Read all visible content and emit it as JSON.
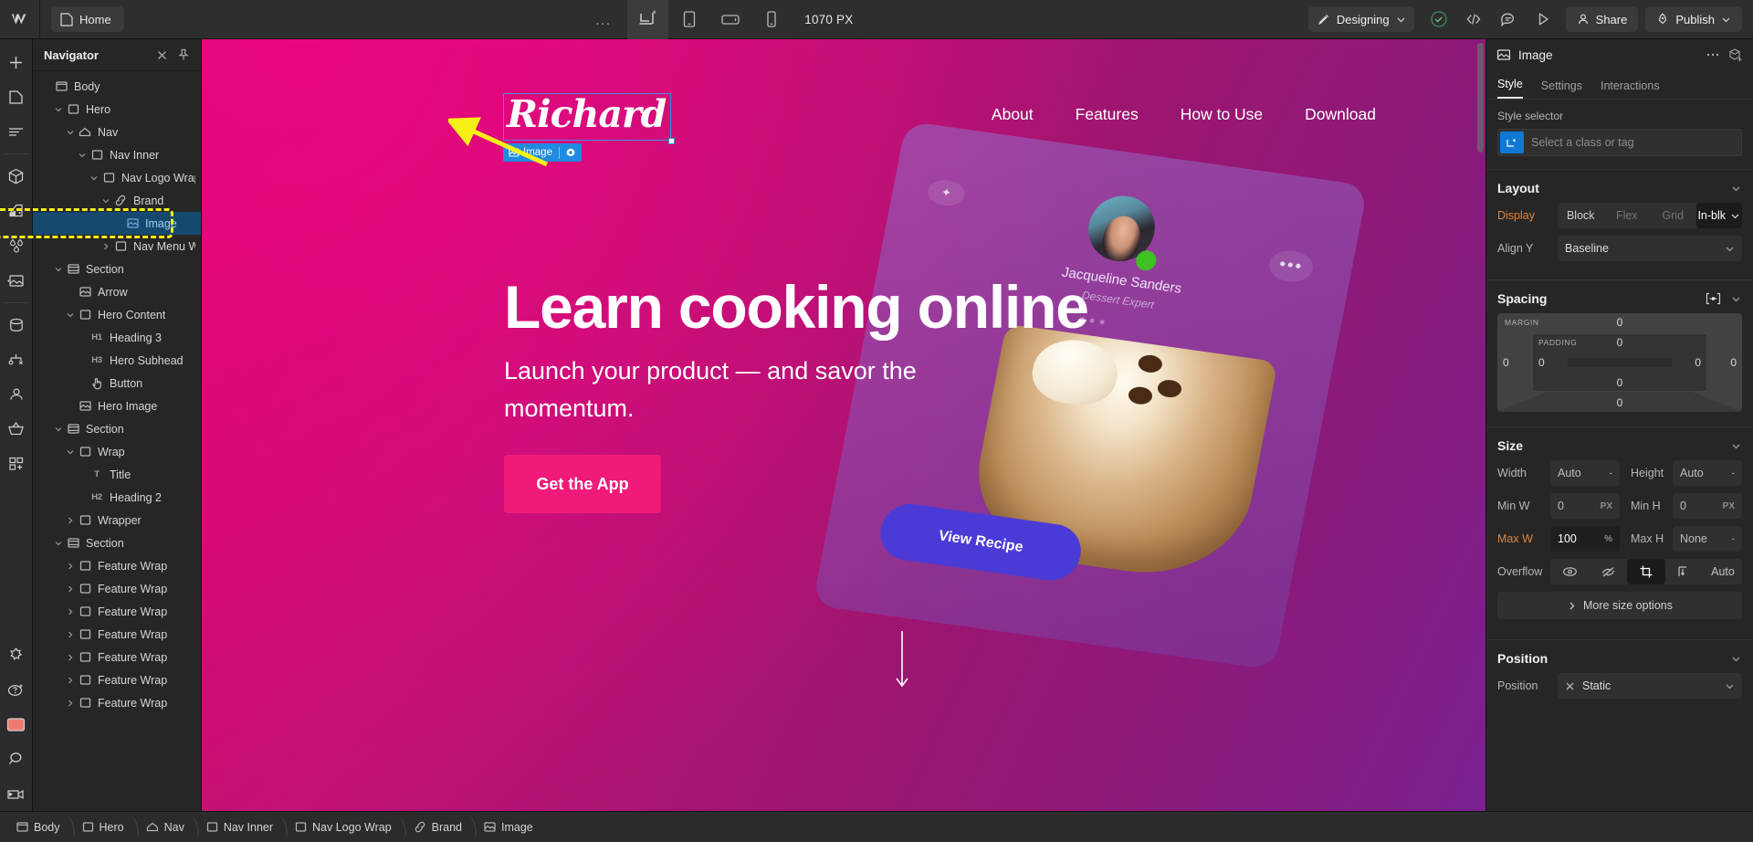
{
  "topbar": {
    "logo_icon": "webflow-logo-icon",
    "page_chip": {
      "label": "Home",
      "icon": "page-icon"
    },
    "more_dots": "...",
    "breakpoints": [
      {
        "name": "desktop",
        "icon": "desktop-breakpoint-icon",
        "active": true
      },
      {
        "name": "tablet",
        "icon": "tablet-breakpoint-icon",
        "active": false
      },
      {
        "name": "mobile-landscape",
        "icon": "mobile-landscape-breakpoint-icon",
        "active": false
      },
      {
        "name": "mobile-portrait",
        "icon": "mobile-portrait-breakpoint-icon",
        "active": false
      }
    ],
    "viewport_width": "1070 PX",
    "mode": {
      "label": "Designing",
      "icon": "paintbrush-icon",
      "chevron": "chevron-down-icon"
    },
    "status_icon": "check-circle-icon",
    "code_icon": "code-brackets-icon",
    "comments_icon": "comment-icon",
    "preview_icon": "play-icon",
    "share": {
      "label": "Share",
      "icon": "person-icon"
    },
    "publish": {
      "label": "Publish",
      "icon": "rocket-icon",
      "chevron": "chevron-down-icon"
    }
  },
  "rail": {
    "items": [
      {
        "name": "add-elements",
        "icon": "plus-icon"
      },
      {
        "name": "pages",
        "icon": "page-icon"
      },
      {
        "name": "navigator",
        "icon": "navigator-lines-icon"
      },
      {
        "name": "components",
        "icon": "cube-icon"
      },
      {
        "name": "variables",
        "icon": "paint-swatch-icon"
      },
      {
        "name": "style-manager",
        "icon": "drops-icon"
      },
      {
        "name": "assets",
        "icon": "image-icon"
      },
      {
        "name": "cms",
        "icon": "database-icon"
      },
      {
        "name": "logic",
        "icon": "logic-node-icon"
      },
      {
        "name": "users",
        "icon": "user-icon"
      },
      {
        "name": "ecommerce",
        "icon": "basket-icon"
      },
      {
        "name": "apps",
        "icon": "apps-grid-icon"
      },
      {
        "name": "ai-assist",
        "icon": "sparkle-icon"
      },
      {
        "name": "help",
        "icon": "question-badge-icon"
      },
      {
        "name": "selected-tool",
        "icon": "red-rect-icon"
      },
      {
        "name": "search",
        "icon": "search-icon"
      },
      {
        "name": "video",
        "icon": "video-camera-icon"
      }
    ]
  },
  "navigator": {
    "title": "Navigator",
    "close_icon": "close-icon",
    "pin_icon": "pin-icon",
    "tree": [
      {
        "label": "Body",
        "depth": 0,
        "icon": "body-box-icon",
        "caret": "",
        "selected": false
      },
      {
        "label": "Hero",
        "depth": 1,
        "icon": "div-box-icon",
        "caret": "down",
        "selected": false
      },
      {
        "label": "Nav",
        "depth": 2,
        "icon": "nav-home-icon",
        "caret": "down",
        "selected": false
      },
      {
        "label": "Nav Inner",
        "depth": 3,
        "icon": "div-box-icon",
        "caret": "down",
        "selected": false
      },
      {
        "label": "Nav Logo Wrap",
        "depth": 4,
        "icon": "div-box-icon",
        "caret": "down",
        "selected": false
      },
      {
        "label": "Brand",
        "depth": 5,
        "icon": "link-icon",
        "caret": "down",
        "selected": false
      },
      {
        "label": "Image",
        "depth": 6,
        "icon": "image-icon",
        "caret": "",
        "selected": true
      },
      {
        "label": "Nav Menu Wrap",
        "depth": 5,
        "icon": "div-box-icon",
        "caret": "right",
        "selected": false
      },
      {
        "label": "Section",
        "depth": 1,
        "icon": "section-icon",
        "caret": "down",
        "selected": false
      },
      {
        "label": "Arrow",
        "depth": 2,
        "icon": "image-icon",
        "caret": "",
        "selected": false
      },
      {
        "label": "Hero Content",
        "depth": 2,
        "icon": "div-box-icon",
        "caret": "down",
        "selected": false
      },
      {
        "label": "Heading 3",
        "depth": 3,
        "icon": "H1",
        "caret": "",
        "selected": false
      },
      {
        "label": "Hero Subhead",
        "depth": 3,
        "icon": "H3",
        "caret": "",
        "selected": false
      },
      {
        "label": "Button",
        "depth": 3,
        "icon": "pointer-hand-icon",
        "caret": "",
        "selected": false
      },
      {
        "label": "Hero Image",
        "depth": 2,
        "icon": "image-icon",
        "caret": "",
        "selected": false
      },
      {
        "label": "Section",
        "depth": 1,
        "icon": "section-icon",
        "caret": "down",
        "selected": false
      },
      {
        "label": "Wrap",
        "depth": 2,
        "icon": "div-box-icon",
        "caret": "down",
        "selected": false
      },
      {
        "label": "Title",
        "depth": 3,
        "icon": "T",
        "caret": "",
        "selected": false
      },
      {
        "label": "Heading 2",
        "depth": 3,
        "icon": "H2",
        "caret": "",
        "selected": false
      },
      {
        "label": "Wrapper",
        "depth": 2,
        "icon": "div-box-icon",
        "caret": "right",
        "selected": false
      },
      {
        "label": "Section",
        "depth": 1,
        "icon": "section-icon",
        "caret": "down",
        "selected": false
      },
      {
        "label": "Feature Wrap",
        "depth": 2,
        "icon": "div-box-icon",
        "caret": "right",
        "selected": false
      },
      {
        "label": "Feature Wrap",
        "depth": 2,
        "icon": "div-box-icon",
        "caret": "right",
        "selected": false
      },
      {
        "label": "Feature Wrap",
        "depth": 2,
        "icon": "div-box-icon",
        "caret": "right",
        "selected": false
      },
      {
        "label": "Feature Wrap",
        "depth": 2,
        "icon": "div-box-icon",
        "caret": "right",
        "selected": false
      },
      {
        "label": "Feature Wrap",
        "depth": 2,
        "icon": "div-box-icon",
        "caret": "right",
        "selected": false
      },
      {
        "label": "Feature Wrap",
        "depth": 2,
        "icon": "div-box-icon",
        "caret": "right",
        "selected": false
      },
      {
        "label": "Feature Wrap",
        "depth": 2,
        "icon": "div-box-icon",
        "caret": "right",
        "selected": false
      }
    ]
  },
  "canvas": {
    "site": {
      "logo_text": "Richard",
      "nav_links": [
        "About",
        "Features",
        "How to Use",
        "Download"
      ],
      "heading": "Learn cooking online",
      "subhead": "Launch your product — and savor the momentum.",
      "cta_label": "Get the App",
      "phone": {
        "person_name": "Jacqueline Sanders",
        "person_role": "Dessert Expert",
        "recipe_label": "View Recipe",
        "star_glyph": "✦",
        "dots_glyph": "•••"
      }
    },
    "selection_badge": {
      "label": "Image",
      "icon": "image-icon",
      "settings_icon": "gear-icon"
    }
  },
  "breadcrumbs": [
    {
      "label": "Body",
      "icon": "body-box-icon"
    },
    {
      "label": "Hero",
      "icon": "div-box-icon"
    },
    {
      "label": "Nav",
      "icon": "nav-home-icon"
    },
    {
      "label": "Nav Inner",
      "icon": "div-box-icon"
    },
    {
      "label": "Nav Logo Wrap",
      "icon": "div-box-icon"
    },
    {
      "label": "Brand",
      "icon": "link-icon"
    },
    {
      "label": "Image",
      "icon": "image-icon"
    }
  ],
  "style_panel": {
    "element_name": "Image",
    "element_icon": "image-icon",
    "more_icon": "ellipsis-icon",
    "component_icon": "create-component-icon",
    "tabs": [
      {
        "label": "Style",
        "active": true
      },
      {
        "label": "Settings",
        "active": false
      },
      {
        "label": "Interactions",
        "active": false
      }
    ],
    "style_selector": {
      "label": "Style selector",
      "placeholder": "Select a class or tag",
      "swatch_icon": "element-tag-icon",
      "swatch_color": "#1078d4"
    },
    "layout": {
      "title": "Layout",
      "display_label": "Display",
      "display_options": [
        "Block",
        "Flex",
        "Grid",
        "In-blk"
      ],
      "display_value": "In-blk",
      "align_y_label": "Align Y",
      "align_y_value": "Baseline"
    },
    "spacing": {
      "title": "Spacing",
      "margin_label": "MARGIN",
      "padding_label": "PADDING",
      "margin_top": "0",
      "margin_right": "0",
      "margin_bottom": "0",
      "margin_left": "0",
      "padding_top": "0",
      "padding_right": "0",
      "padding_bottom": "0",
      "padding_left": "0",
      "link_icon": "spacing-link-icon"
    },
    "size": {
      "title": "Size",
      "width_label": "Width",
      "width_value": "Auto",
      "width_unit": "-",
      "height_label": "Height",
      "height_value": "Auto",
      "height_unit": "-",
      "minw_label": "Min W",
      "minw_value": "0",
      "minw_unit": "PX",
      "minh_label": "Min H",
      "minh_value": "0",
      "minh_unit": "PX",
      "maxw_label": "Max W",
      "maxw_value": "100",
      "maxw_unit": "%",
      "maxh_label": "Max H",
      "maxh_value": "None",
      "maxh_unit": "-",
      "overflow_label": "Overflow",
      "overflow_options": [
        "visible-eye-icon",
        "hidden-eye-slash-icon",
        "scroll-crop-icon",
        "auto-bars-icon"
      ],
      "overflow_auto_label": "Auto",
      "more_size_label": "More size options"
    },
    "position": {
      "title": "Position",
      "position_label": "Position",
      "position_value": "Static",
      "clear_icon": "close-icon"
    }
  }
}
